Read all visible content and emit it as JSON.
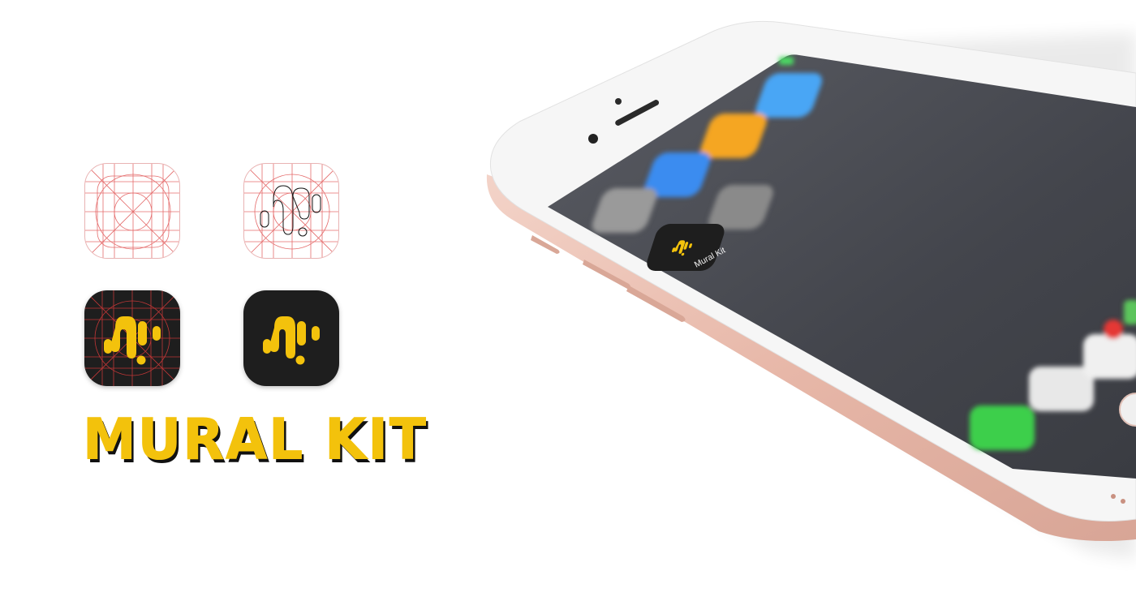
{
  "brand": {
    "wordmark": "MURAL KIT",
    "accent_color": "#f3c20c",
    "dark_color": "#1e1e1e",
    "grid_color": "#e05050"
  },
  "icons": [
    {
      "name": "icon-grid-template",
      "style": "grid-outline"
    },
    {
      "name": "icon-grid-sketch",
      "style": "grid-with-outline-logo"
    },
    {
      "name": "icon-grid-dark",
      "style": "dark-with-grid"
    },
    {
      "name": "icon-final",
      "style": "dark-final"
    }
  ],
  "phone": {
    "app_label": "Mural Kit",
    "app_icon": "mural-kit-icon",
    "home_icons": [
      "camera-icon",
      "settings-icon",
      "weather-icon",
      "calculator-icon",
      "app-store-icon",
      "photos-icon",
      "calendar-icon",
      "messages-icon",
      "mail-icon"
    ]
  }
}
